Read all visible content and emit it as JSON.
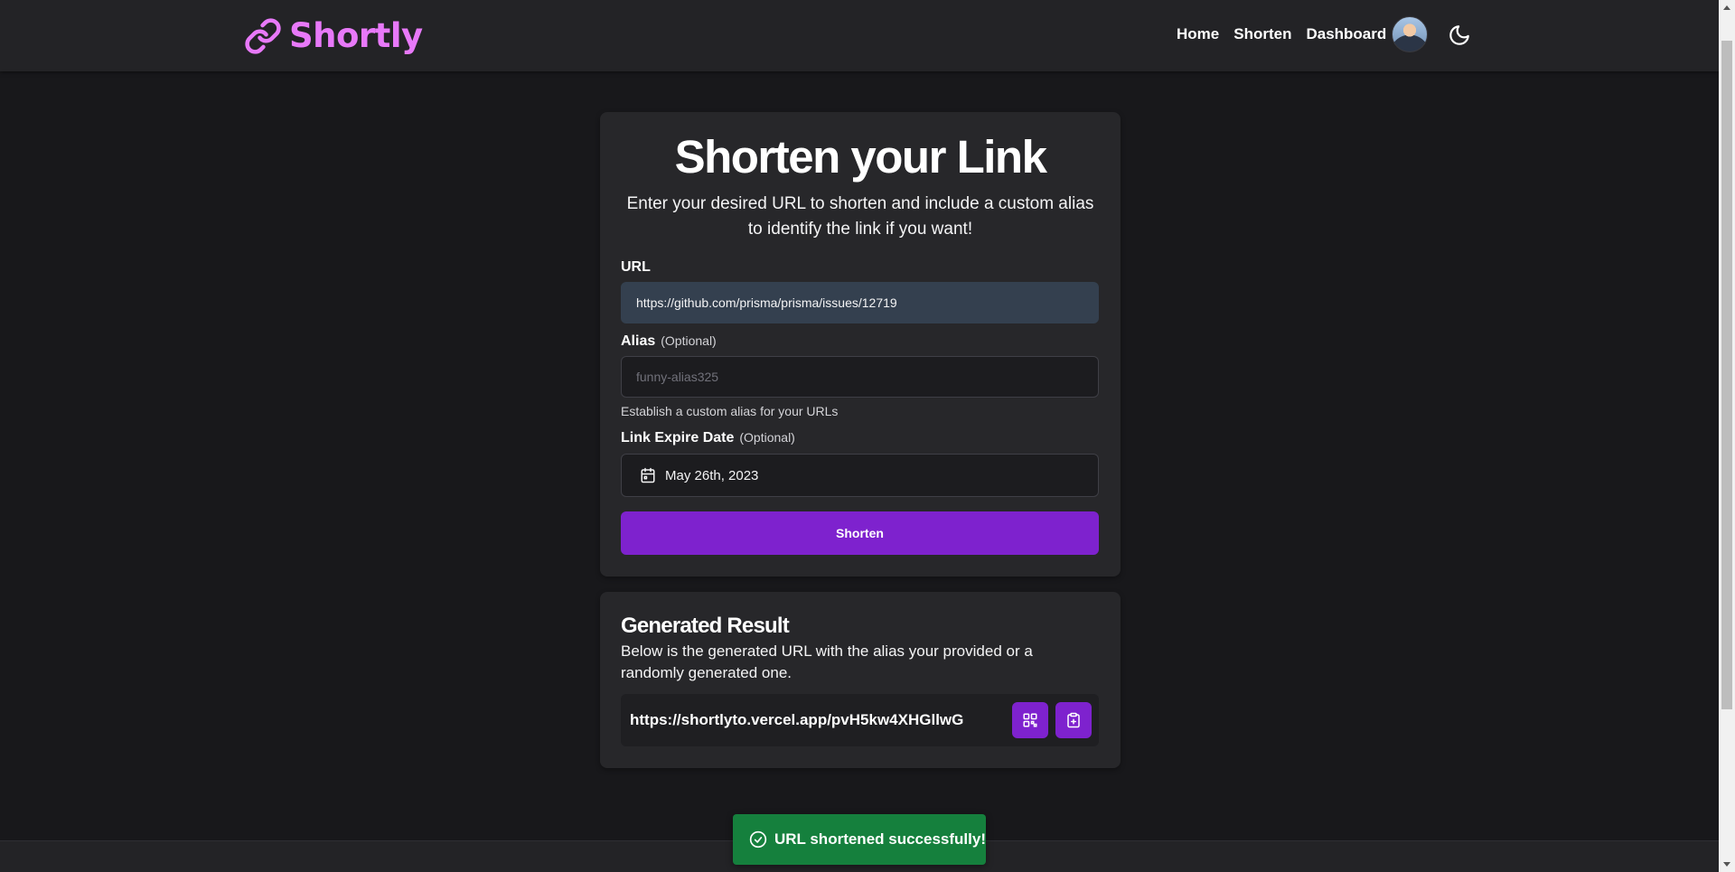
{
  "header": {
    "brand": "Shortly",
    "nav": [
      {
        "label": "Home"
      },
      {
        "label": "Shorten"
      },
      {
        "label": "Dashboard"
      }
    ]
  },
  "form": {
    "title": "Shorten your Link",
    "subtitle": "Enter your desired URL to shorten and include a custom alias to identify the link if you want!",
    "url_label": "URL",
    "url_value": "https://github.com/prisma/prisma/issues/12719",
    "alias_label": "Alias",
    "alias_optional": "(Optional)",
    "alias_placeholder": "funny-alias325",
    "alias_helper": "Establish a custom alias for your URLs",
    "expire_label": "Link Expire Date",
    "expire_optional": "(Optional)",
    "expire_value": "May 26th, 2023",
    "submit_label": "Shorten"
  },
  "result": {
    "title": "Generated Result",
    "subtitle": "Below is the generated URL with the alias your provided or a randomly generated one.",
    "url": "https://shortlyto.vercel.app/pvH5kw4XHGllwG"
  },
  "toast": {
    "message": "URL shortened successfully!"
  },
  "colors": {
    "accent": "#7e22ce",
    "brand": "#e879f9",
    "success": "#15803d",
    "background": "#18181b",
    "card": "#27272a"
  }
}
